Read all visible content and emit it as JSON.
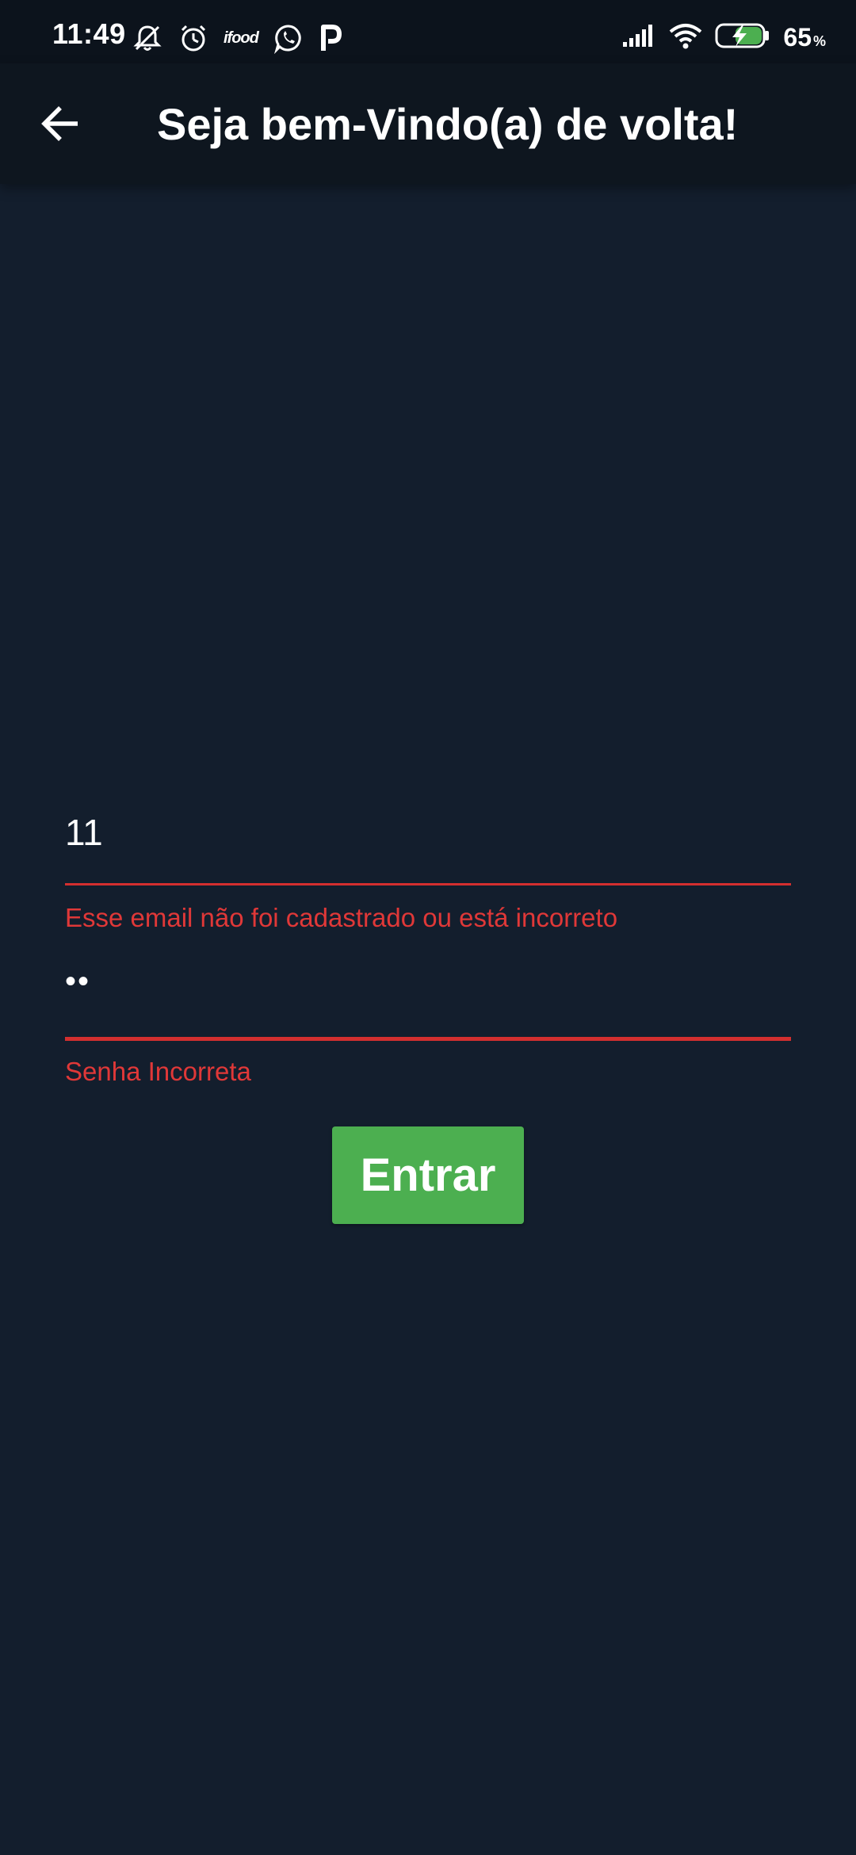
{
  "status_bar": {
    "time": "11:49",
    "left_icons": [
      "muted-bell-icon",
      "alarm-clock-icon",
      "ifood-icon",
      "whatsapp-icon",
      "p-app-icon"
    ],
    "ifood_label": "ifood",
    "right_icons": [
      "cellular-signal-icon",
      "wifi-icon",
      "battery-charging-icon"
    ],
    "battery_level": "65",
    "battery_unit": "%"
  },
  "app_bar": {
    "back_icon": "arrow-left-icon",
    "title": "Seja bem-Vindo(a) de volta!"
  },
  "form": {
    "email": {
      "value": "11",
      "error": "Esse email não foi cadastrado ou está incorreto",
      "state": "error"
    },
    "password": {
      "value": "••",
      "error": "Senha Incorreta",
      "state": "error"
    },
    "submit_label": "Entrar"
  },
  "colors": {
    "background": "#131e2d",
    "app_bar": "#0e161f",
    "status_bar": "#0c131c",
    "error": "#d32f2f",
    "button": "#4caf50",
    "battery_fill": "#4caf50"
  }
}
